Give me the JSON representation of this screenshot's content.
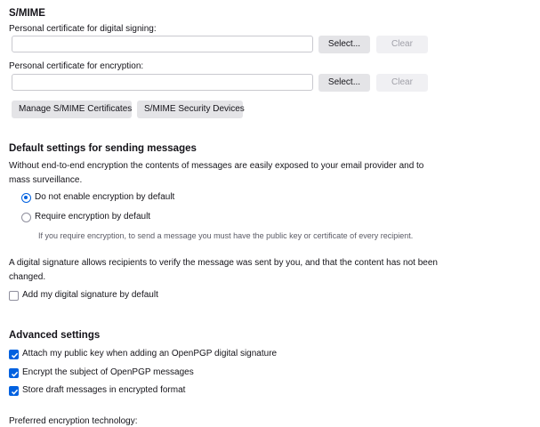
{
  "smime": {
    "heading": "S/MIME",
    "signing_label": "Personal certificate for digital signing:",
    "signing_value": "",
    "encryption_label": "Personal certificate for encryption:",
    "encryption_value": "",
    "select_label": "Select...",
    "clear_label": "Clear",
    "manage_certs_label": "Manage S/MIME Certificates",
    "security_devices_label": "S/MIME Security Devices"
  },
  "defaults": {
    "heading": "Default settings for sending messages",
    "description": "Without end-to-end encryption the contents of messages are easily exposed to your email provider and to mass surveillance.",
    "radio_options": [
      {
        "label": "Do not enable encryption by default",
        "selected": true
      },
      {
        "label": "Require encryption by default",
        "selected": false
      }
    ],
    "require_hint": "If you require encryption, to send a message you must have the public key or certificate of every recipient.",
    "signature_description": "A digital signature allows recipients to verify the message was sent by you, and that the content has not been changed.",
    "signature_checkbox": {
      "label": "Add my digital signature by default",
      "checked": false
    }
  },
  "advanced": {
    "heading": "Advanced settings",
    "options": [
      {
        "label": "Attach my public key when adding an OpenPGP digital signature",
        "checked": true
      },
      {
        "label": "Encrypt the subject of OpenPGP messages",
        "checked": true
      },
      {
        "label": "Store draft messages in encrypted format",
        "checked": true
      }
    ],
    "preferred_label": "Preferred encryption technology:"
  },
  "colors": {
    "accent": "#0061e0",
    "button_bg": "#e4e4e7"
  }
}
